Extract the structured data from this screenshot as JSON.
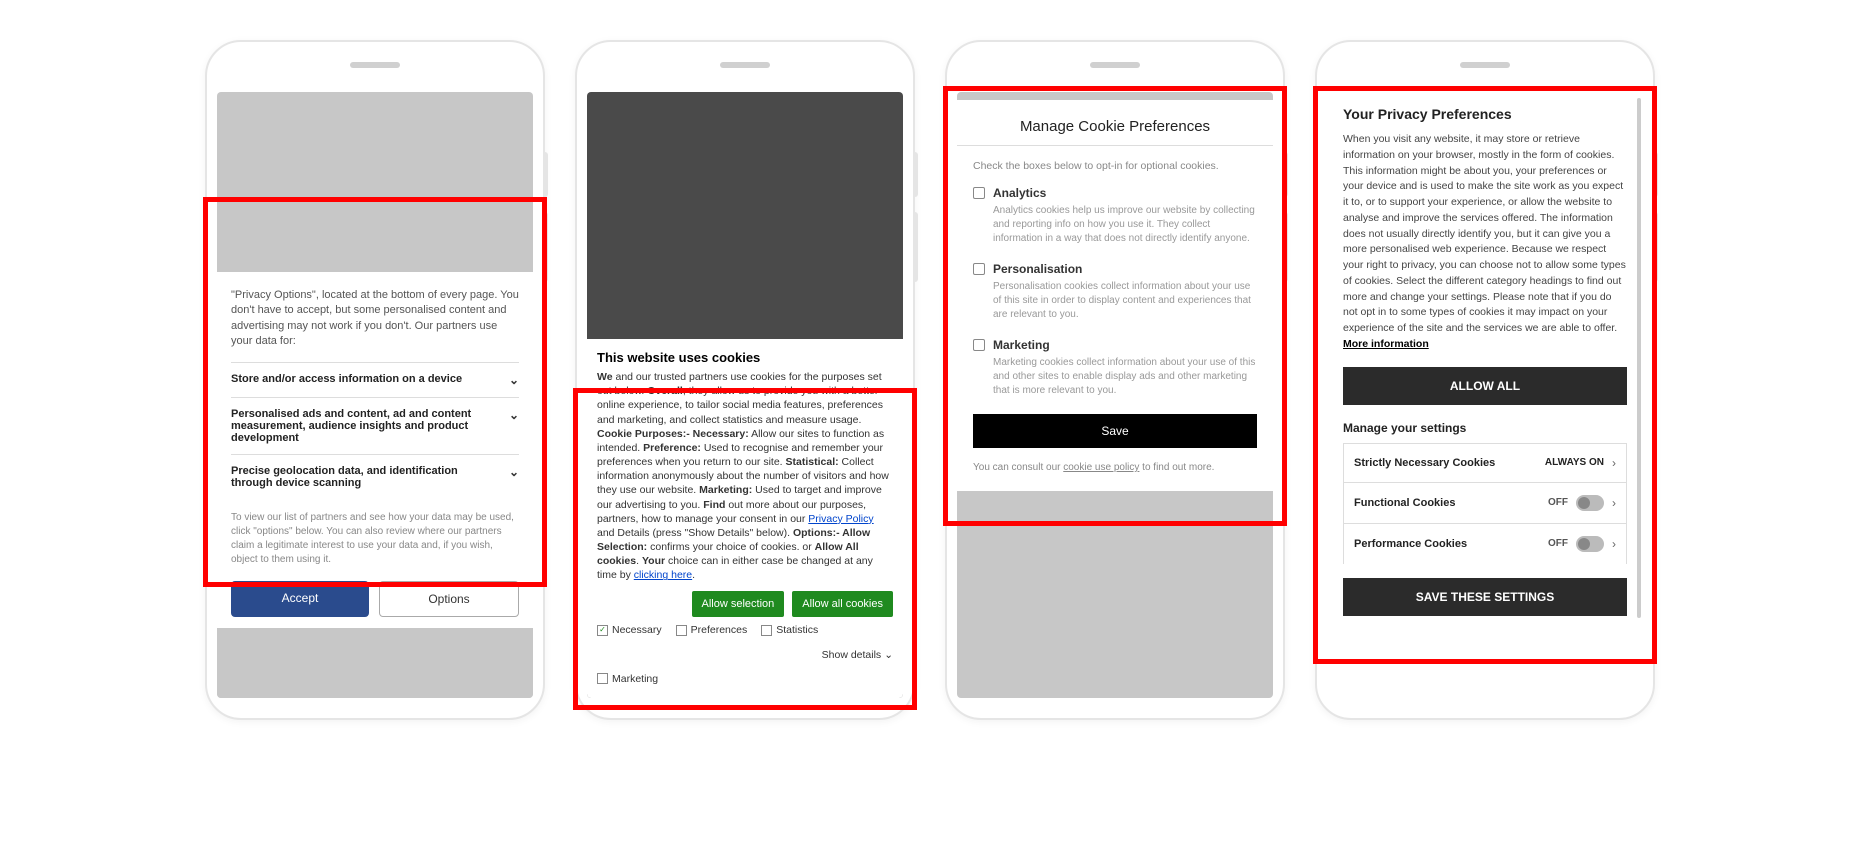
{
  "phone1": {
    "intro": "\"Privacy Options\", located at the bottom of every page. You don't have to accept, but some personalised content and advertising may not work if you don't. Our partners use your data for:",
    "items": [
      "Store and/or access information on a device",
      "Personalised ads and content, ad and content measurement, audience insights and product development",
      "Precise geolocation data, and identification through device scanning"
    ],
    "footnote": "To view our list of partners and see how your data may be used, click \"options\" below. You can also review where our partners claim a legitimate interest to use your data and, if you wish, object to them using it.",
    "accept": "Accept",
    "options": "Options"
  },
  "phone2": {
    "title": "This website uses cookies",
    "body_fragments": {
      "f1_b": "We",
      "f1": " and our trusted partners use cookies for the purposes set out below. ",
      "f2_b": "Overall",
      "f2": ", they allow us to provide you with a better online experience, to tailor social media features, preferences and marketing, and collect statistics and measure usage. ",
      "f3_b": "Cookie Purposes:- Necessary:",
      "f3": " Allow our sites to function as intended. ",
      "f4_b": "Preference:",
      "f4": " Used to recognise and remember your preferences when you return to our site. ",
      "f5_b": "Statistical:",
      "f5": " Collect information anonymously about the number of visitors and how they use our website. ",
      "f6_b": "Marketing:",
      "f6": " Used to target and improve our advertising to you. ",
      "f7_b": "Find",
      "f7": " out more about our purposes, partners, how to manage your consent in our ",
      "f7_link": "Privacy Policy",
      "f8": " and Details (press \"Show Details\" below). ",
      "f9_b": "Options:- Allow Selection:",
      "f9": " confirms your choice of cookies. or ",
      "f10_b": "Allow All cookies",
      "f10": ". ",
      "f11_b": "Your",
      "f11": " choice can in either case be changed at any time by ",
      "f11_link": "clicking here",
      "f11_end": "."
    },
    "btn_allow_selection": "Allow selection",
    "btn_allow_all": "Allow all cookies",
    "checks": {
      "necessary": "Necessary",
      "preferences": "Preferences",
      "statistics": "Statistics",
      "marketing": "Marketing"
    },
    "show_details": "Show details"
  },
  "phone3": {
    "title": "Manage Cookie Preferences",
    "sub": "Check the boxes below to opt-in for optional cookies.",
    "opts": [
      {
        "label": "Analytics",
        "desc": "Analytics cookies help us improve our website by collecting and reporting info on how you use it. They collect information in a way that does not directly identify anyone."
      },
      {
        "label": "Personalisation",
        "desc": "Personalisation cookies collect information about your use of this site in order to display content and experiences that are relevant to you."
      },
      {
        "label": "Marketing",
        "desc": "Marketing cookies collect information about your use of this and other sites to enable display ads and other marketing that is more relevant to you."
      }
    ],
    "save": "Save",
    "foot1": "You can consult our ",
    "foot_link": "cookie use policy",
    "foot2": " to find out more."
  },
  "phone4": {
    "title": "Your Privacy Preferences",
    "body": "When you visit any website, it may store or retrieve information on your browser, mostly in the form of cookies. This information might be about you, your preferences or your device and is used to make the site work as you expect it to, or to support your experience, or allow the website to analyse and improve the services offered. The information does not usually directly identify you, but it can give you a more personalised web experience. Because we respect your right to privacy, you can choose not to allow some types of cookies. Select the different category headings to find out more and change your settings. Please note that if you do not opt in to some types of cookies it may impact on your experience of the site and the services we are able to offer.  ",
    "more_info": "More information",
    "allow_all": "ALLOW ALL",
    "subtitle": "Manage your settings",
    "rows": [
      {
        "label": "Strictly Necessary Cookies",
        "state": "ALWAYS ON",
        "toggle": false
      },
      {
        "label": "Functional Cookies",
        "state": "OFF",
        "toggle": true
      },
      {
        "label": "Performance Cookies",
        "state": "OFF",
        "toggle": true
      }
    ],
    "save": "SAVE THESE SETTINGS"
  }
}
